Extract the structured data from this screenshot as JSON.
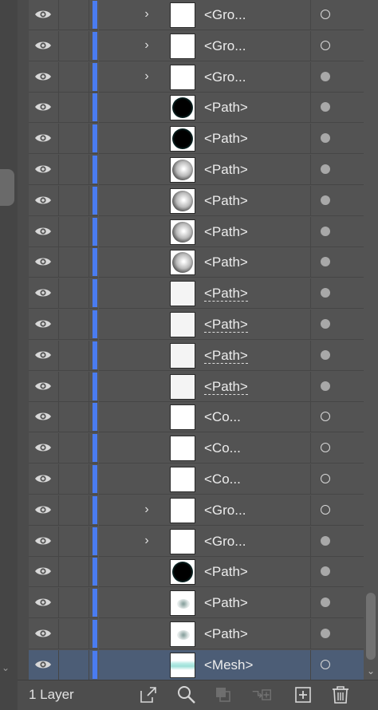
{
  "layers": [
    {
      "name": "<Gro...",
      "expandable": true,
      "thumb": "white",
      "target": "hollow"
    },
    {
      "name": "<Gro...",
      "expandable": true,
      "thumb": "white",
      "target": "hollow"
    },
    {
      "name": "<Gro...",
      "expandable": true,
      "thumb": "white",
      "target": "filled"
    },
    {
      "name": "<Path>",
      "expandable": false,
      "thumb": "dark-circle",
      "target": "filled"
    },
    {
      "name": "<Path>",
      "expandable": false,
      "thumb": "dark-circle",
      "target": "filled"
    },
    {
      "name": "<Path>",
      "expandable": false,
      "thumb": "grad-circle",
      "target": "filled"
    },
    {
      "name": "<Path>",
      "expandable": false,
      "thumb": "grad-circle",
      "target": "filled"
    },
    {
      "name": "<Path>",
      "expandable": false,
      "thumb": "grad-circle",
      "target": "filled"
    },
    {
      "name": "<Path>",
      "expandable": false,
      "thumb": "grad-circle",
      "target": "filled"
    },
    {
      "name": "<Path>",
      "expandable": false,
      "thumb": "faint",
      "target": "filled",
      "dashed": true
    },
    {
      "name": "<Path>",
      "expandable": false,
      "thumb": "faint",
      "target": "filled",
      "dashed": true
    },
    {
      "name": "<Path>",
      "expandable": false,
      "thumb": "faint",
      "target": "filled",
      "dashed": true
    },
    {
      "name": "<Path>",
      "expandable": false,
      "thumb": "faint",
      "target": "filled",
      "dashed": true
    },
    {
      "name": "<Co...",
      "expandable": false,
      "thumb": "white",
      "target": "hollow"
    },
    {
      "name": "<Co...",
      "expandable": false,
      "thumb": "white",
      "target": "hollow"
    },
    {
      "name": "<Co...",
      "expandable": false,
      "thumb": "white",
      "target": "hollow"
    },
    {
      "name": "<Gro...",
      "expandable": true,
      "thumb": "white",
      "target": "hollow"
    },
    {
      "name": "<Gro...",
      "expandable": true,
      "thumb": "white",
      "target": "filled"
    },
    {
      "name": "<Path>",
      "expandable": false,
      "thumb": "dark-circle",
      "target": "filled"
    },
    {
      "name": "<Path>",
      "expandable": false,
      "thumb": "blur-dot",
      "target": "filled"
    },
    {
      "name": "<Path>",
      "expandable": false,
      "thumb": "blur-dot",
      "target": "filled"
    },
    {
      "name": "<Mesh>",
      "expandable": false,
      "thumb": "mesh",
      "target": "hollow",
      "selected": true
    }
  ],
  "footer": {
    "layer_count": "1 Layer"
  },
  "colors": {
    "layer_color": "#4a7cf0",
    "selected_row": "#4c5d76",
    "panel_bg": "#535353"
  },
  "icons": {
    "expand": "chevron-right-icon",
    "visibility": "eye-icon",
    "footer": [
      "export-icon",
      "search-icon",
      "clipping-mask-icon",
      "new-sublayer-icon",
      "new-layer-icon",
      "trash-icon"
    ]
  }
}
